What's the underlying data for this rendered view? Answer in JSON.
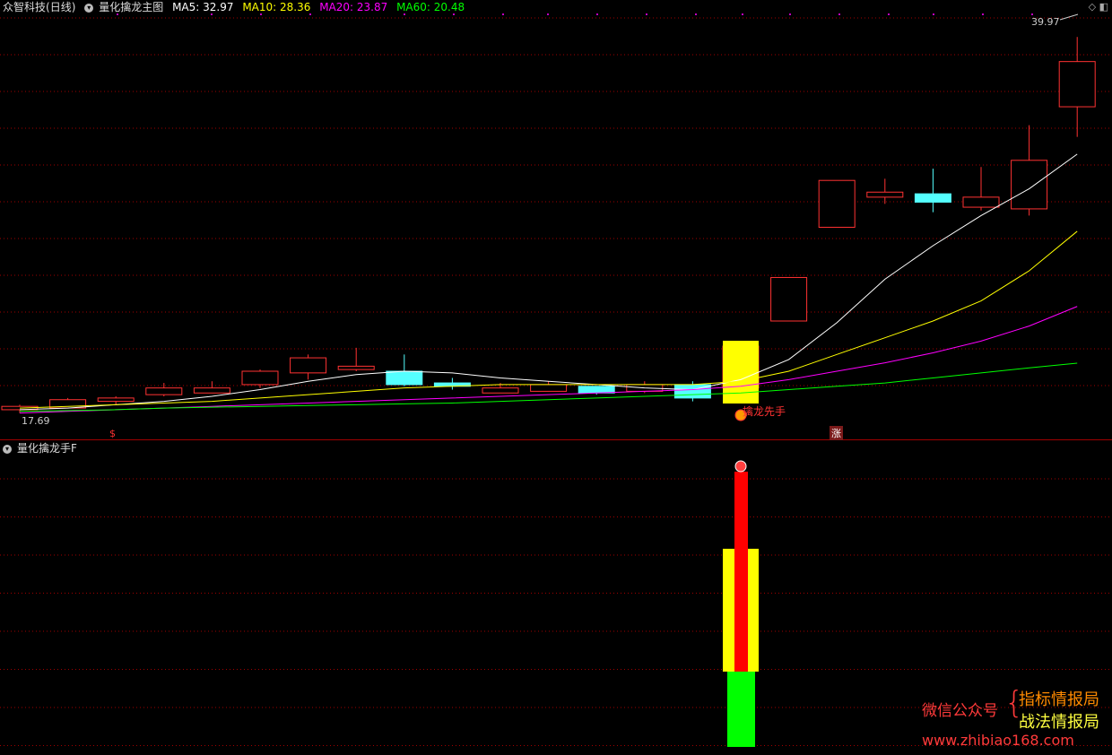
{
  "main_panel": {
    "stock_name": "众智科技",
    "period": "(日线)",
    "indicator_name": "量化擒龙主图",
    "ma5_label": "MA5: 32.97",
    "ma10_label": "MA10: 28.36",
    "ma20_label": "MA20: 23.87",
    "ma60_label": "MA60: 20.48",
    "high_price_label": "39.97",
    "low_price_label": "17.69",
    "signal_label": "擒龙先手",
    "marker_left": "$",
    "marker_right": "涨",
    "colors": {
      "ma5": "#ffffff",
      "ma10": "#ffff00",
      "ma20": "#ff00ff",
      "ma60": "#00ff00",
      "up": "#ff3232",
      "down": "#54ffff",
      "grid": "#a00000"
    }
  },
  "sub_panel": {
    "indicator_name": "量化擒龙手F"
  },
  "watermark": {
    "left_text": "微信公众号",
    "line1": "指标情报局",
    "line2": "战法情报局",
    "url": "www.zhibiao168.com"
  },
  "chart_data": {
    "type": "candlestick",
    "series": [
      {
        "name": "candles",
        "values": [
          {
            "o": 17.7,
            "h": 18.0,
            "l": 17.5,
            "c": 17.9
          },
          {
            "o": 17.8,
            "h": 18.4,
            "l": 17.8,
            "c": 18.3
          },
          {
            "o": 18.2,
            "h": 18.5,
            "l": 18.0,
            "c": 18.4
          },
          {
            "o": 18.6,
            "h": 19.3,
            "l": 18.5,
            "c": 19.0
          },
          {
            "o": 18.7,
            "h": 19.4,
            "l": 18.7,
            "c": 19.0
          },
          {
            "o": 19.2,
            "h": 20.1,
            "l": 19.0,
            "c": 20.0
          },
          {
            "o": 19.9,
            "h": 21.0,
            "l": 19.5,
            "c": 20.8
          },
          {
            "o": 20.1,
            "h": 21.4,
            "l": 20.0,
            "c": 20.3
          },
          {
            "o": 20.0,
            "h": 21.0,
            "l": 19.1,
            "c": 19.2
          },
          {
            "o": 19.3,
            "h": 19.6,
            "l": 18.9,
            "c": 19.1
          },
          {
            "o": 18.7,
            "h": 19.3,
            "l": 18.7,
            "c": 19.0
          },
          {
            "o": 18.8,
            "h": 19.4,
            "l": 18.8,
            "c": 19.2
          },
          {
            "o": 19.1,
            "h": 19.1,
            "l": 18.6,
            "c": 18.7
          },
          {
            "o": 18.8,
            "h": 19.4,
            "l": 18.7,
            "c": 19.2
          },
          {
            "o": 19.2,
            "h": 19.4,
            "l": 18.2,
            "c": 18.4
          },
          {
            "o": 19.0,
            "h": 21.5,
            "l": 18.8,
            "c": 21.5
          },
          {
            "o": 23.0,
            "h": 25.6,
            "l": 23.0,
            "c": 25.6
          },
          {
            "o": 28.6,
            "h": 31.4,
            "l": 28.6,
            "c": 31.4
          },
          {
            "o": 30.4,
            "h": 31.5,
            "l": 30.0,
            "c": 30.7
          },
          {
            "o": 30.6,
            "h": 32.1,
            "l": 29.5,
            "c": 30.1
          },
          {
            "o": 29.8,
            "h": 32.2,
            "l": 29.6,
            "c": 30.4
          },
          {
            "o": 29.7,
            "h": 34.7,
            "l": 29.3,
            "c": 32.6
          },
          {
            "o": 35.8,
            "h": 39.97,
            "l": 34.0,
            "c": 38.5
          }
        ]
      },
      {
        "name": "MA5",
        "values": [
          17.7,
          17.8,
          18.0,
          18.2,
          18.5,
          18.9,
          19.4,
          19.8,
          20.0,
          19.9,
          19.6,
          19.4,
          19.2,
          19.0,
          18.9,
          19.5,
          20.7,
          22.9,
          25.5,
          27.5,
          29.3,
          30.9,
          32.97
        ]
      },
      {
        "name": "MA10",
        "values": [
          17.8,
          17.9,
          18.0,
          18.1,
          18.2,
          18.4,
          18.6,
          18.8,
          19.0,
          19.1,
          19.2,
          19.2,
          19.2,
          19.2,
          19.2,
          19.4,
          20.0,
          21.0,
          22.0,
          23.0,
          24.2,
          26.0,
          28.36
        ]
      },
      {
        "name": "MA20",
        "values": [
          17.5,
          17.6,
          17.7,
          17.8,
          17.9,
          18.0,
          18.1,
          18.2,
          18.3,
          18.4,
          18.5,
          18.6,
          18.7,
          18.8,
          18.9,
          19.1,
          19.5,
          20.0,
          20.5,
          21.1,
          21.8,
          22.7,
          23.87
        ]
      },
      {
        "name": "MA60",
        "values": [
          17.6,
          17.65,
          17.7,
          17.8,
          17.85,
          17.9,
          17.95,
          18.0,
          18.05,
          18.1,
          18.2,
          18.3,
          18.4,
          18.5,
          18.6,
          18.7,
          18.9,
          19.1,
          19.3,
          19.6,
          19.9,
          20.2,
          20.48
        ]
      }
    ],
    "signal_index": 15,
    "ylim": [
      17.0,
      41.0
    ]
  }
}
